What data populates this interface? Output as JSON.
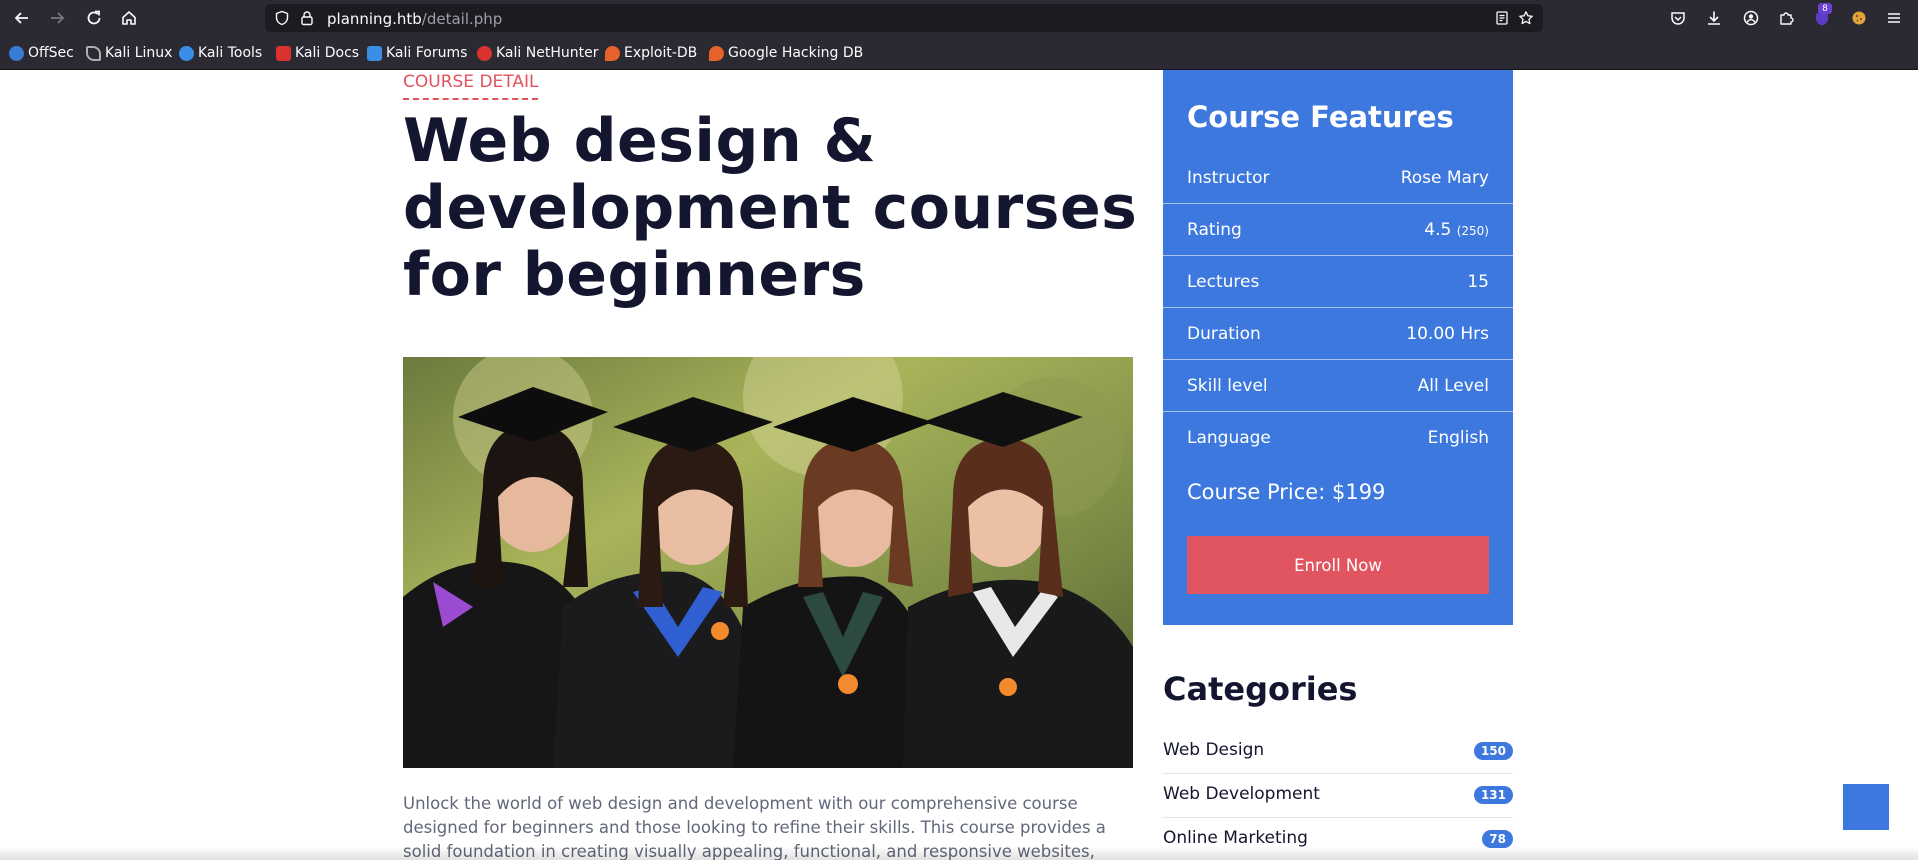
{
  "browser": {
    "url_host": "planning.htb",
    "url_path": "/detail.php",
    "extension_badge_count": "8",
    "bookmarks": [
      {
        "label": "OffSec",
        "icon": "offsec-icon",
        "color": "#3a7bd5"
      },
      {
        "label": "Kali Linux",
        "icon": "kali-dragon-icon",
        "color": "#b0b0b0"
      },
      {
        "label": "Kali Tools",
        "icon": "kali-tools-icon",
        "color": "#3a8ee6"
      },
      {
        "label": "Kali Docs",
        "icon": "kali-docs-icon",
        "color": "#d9322f"
      },
      {
        "label": "Kali Forums",
        "icon": "kali-forums-icon",
        "color": "#3a8ee6"
      },
      {
        "label": "Kali NetHunter",
        "icon": "kali-nethunter-icon",
        "color": "#d9322f"
      },
      {
        "label": "Exploit-DB",
        "icon": "exploit-db-icon",
        "color": "#e8622c"
      },
      {
        "label": "Google Hacking DB",
        "icon": "ghdb-icon",
        "color": "#e8622c"
      }
    ]
  },
  "page": {
    "eyebrow": "COURSE DETAIL",
    "title": "Web design & development courses for beginners",
    "description": "Unlock the world of web design and development with our comprehensive course designed for beginners and those looking to refine their skills. This course provides a solid foundation in creating visually appealing, functional, and responsive websites, equipping"
  },
  "features": {
    "title": "Course Features",
    "rows": [
      {
        "label": "Instructor",
        "value": "Rose Mary",
        "sub": ""
      },
      {
        "label": "Rating",
        "value": "4.5",
        "sub": "(250)"
      },
      {
        "label": "Lectures",
        "value": "15",
        "sub": ""
      },
      {
        "label": "Duration",
        "value": "10.00 Hrs",
        "sub": ""
      },
      {
        "label": "Skill level",
        "value": "All Level",
        "sub": ""
      },
      {
        "label": "Language",
        "value": "English",
        "sub": ""
      }
    ],
    "price": "Course Price: $199",
    "enroll_label": "Enroll Now"
  },
  "categories": {
    "title": "Categories",
    "items": [
      {
        "label": "Web Design",
        "count": "150"
      },
      {
        "label": "Web Development",
        "count": "131"
      },
      {
        "label": "Online Marketing",
        "count": "78"
      }
    ]
  },
  "colors": {
    "accent_blue": "#3d78de",
    "accent_red": "#e0555f",
    "heading": "#14152f"
  }
}
